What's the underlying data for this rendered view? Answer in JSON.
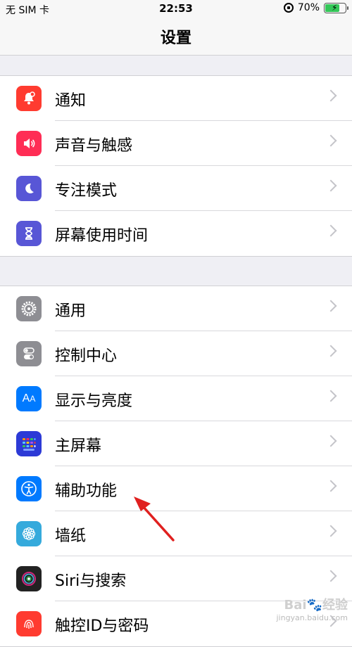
{
  "status": {
    "carrier": "无 SIM 卡",
    "time": "22:53",
    "battery": "70%",
    "battery_level": 0.7
  },
  "nav": {
    "title": "设置"
  },
  "groups": [
    {
      "items": [
        {
          "label": "通知",
          "icon": "notification-icon",
          "color": "#ff3b30"
        },
        {
          "label": "声音与触感",
          "icon": "speaker-icon",
          "color": "#ff2d55"
        },
        {
          "label": "专注模式",
          "icon": "moon-icon",
          "color": "#5856d6"
        },
        {
          "label": "屏幕使用时间",
          "icon": "hourglass-icon",
          "color": "#5856d6"
        }
      ]
    },
    {
      "items": [
        {
          "label": "通用",
          "icon": "gear-icon",
          "color": "#8e8e93"
        },
        {
          "label": "控制中心",
          "icon": "toggles-icon",
          "color": "#8e8e93"
        },
        {
          "label": "显示与亮度",
          "icon": "text-size-icon",
          "color": "#007aff"
        },
        {
          "label": "主屏幕",
          "icon": "home-grid-icon",
          "color": "#2c3ad6"
        },
        {
          "label": "辅助功能",
          "icon": "accessibility-icon",
          "color": "#007aff"
        },
        {
          "label": "墙纸",
          "icon": "flower-icon",
          "color": "#35aadc"
        },
        {
          "label": "Siri与搜索",
          "icon": "siri-icon",
          "color": "#222222"
        },
        {
          "label": "触控ID与密码",
          "icon": "fingerprint-icon",
          "color": "#ff3b30"
        }
      ]
    }
  ],
  "watermark": {
    "line1": "Bai🐾经验",
    "line2": "jingyan.baidu.com"
  }
}
